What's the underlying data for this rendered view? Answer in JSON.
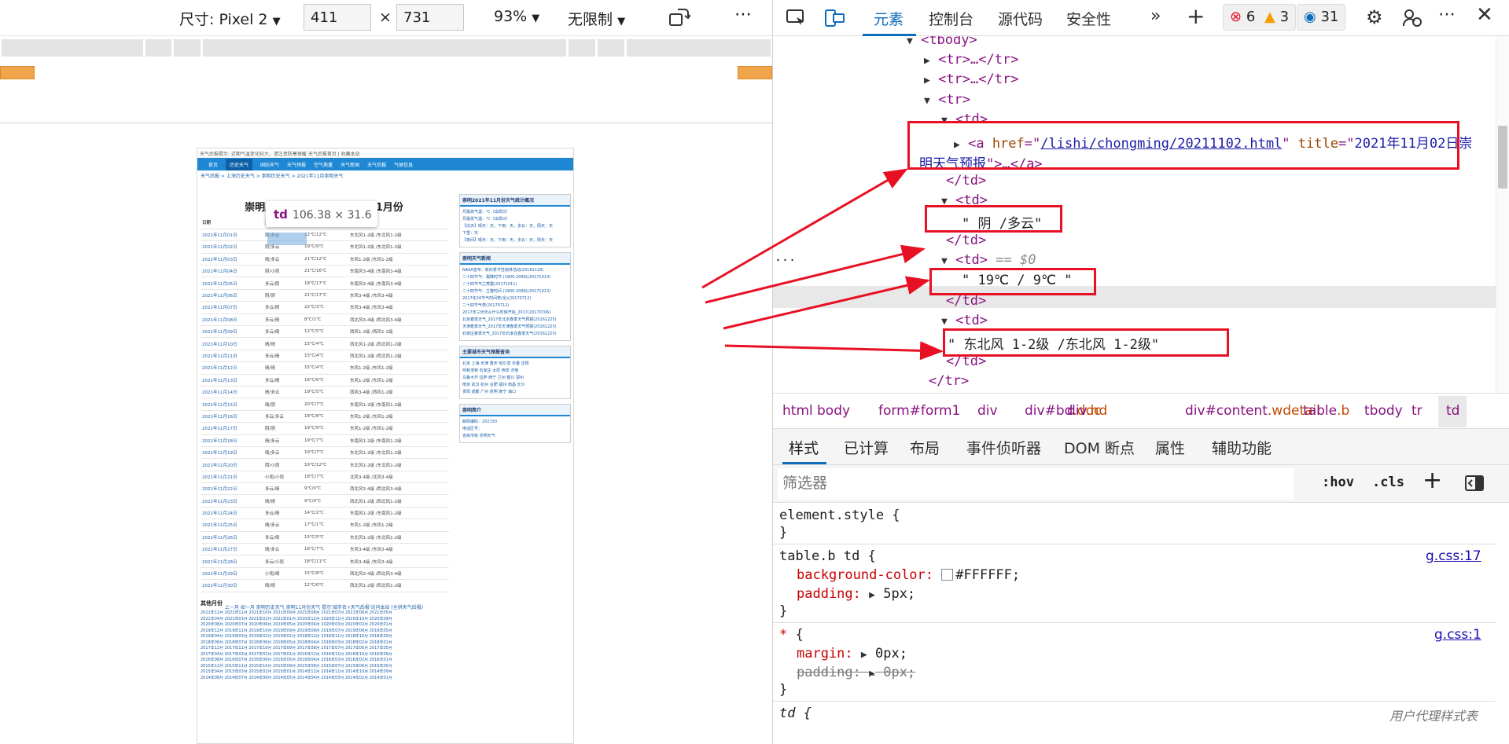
{
  "device_toolbar": {
    "size_label": "尺寸: Pixel 2",
    "width": "411",
    "x_sep": "×",
    "height": "731",
    "zoom": "93%",
    "throttle": "无限制"
  },
  "viewport_page": {
    "top_text": "天气后报提示: 近期气温变化较大，请注意防寒保暖   天气后报首页 | 收藏本站",
    "nav": [
      "首页",
      "历史天气",
      "国际天气",
      "天气预报",
      "空气质量",
      "天气新闻",
      "天气后报",
      "气候信息"
    ],
    "crumb": "天气后报 > 上海历史天气 > 崇明历史天气 > 2021年11月崇明天气",
    "title": "崇明历史天气预报 2021年11月份",
    "table_header": [
      "日期",
      "天气状况",
      "气温",
      "风力风向"
    ],
    "rows": [
      [
        "2021年11月01日",
        "阴/多云",
        "22℃/12℃",
        "东北风1-2级 /东北风1-2级"
      ],
      [
        "2021年11月02日",
        "阴/多云",
        "19℃/9℃",
        "东北风1-2级 /东北风1-2级"
      ],
      [
        "2021年11月03日",
        "晴/多云",
        "21℃/12℃",
        "东风1-2级 /东风1-2级"
      ],
      [
        "2021年11月04日",
        "阴/小雨",
        "21℃/16℃",
        "东南风3-4级 /东南风3-4级"
      ],
      [
        "2021年11月05日",
        "多云/阴",
        "18℃/17℃",
        "东南风3-4级 /东南风3-4级"
      ],
      [
        "2021年11月06日",
        "阴/阴",
        "21℃/17℃",
        "东风3-4级 /东风3-4级"
      ],
      [
        "2021年11月07日",
        "多云/阴",
        "22℃/3℃",
        "东风3-4级 /东风3-4级"
      ],
      [
        "2021年11月08日",
        "多云/晴",
        "8℃/1℃",
        "西北风3-4级 /西北风3-4级"
      ],
      [
        "2021年11月09日",
        "多云/晴",
        "12℃/5℃",
        "西风1-2级 /西风1-2级"
      ],
      [
        "2021年11月10日",
        "晴/晴",
        "15℃/4℃",
        "西北风1-2级 /西北风1-2级"
      ],
      [
        "2021年11月11日",
        "多云/晴",
        "15℃/4℃",
        "西北风1-2级 /西北风1-2级"
      ],
      [
        "2021年11月12日",
        "晴/晴",
        "15℃/4℃",
        "东风1-2级 /东风1-2级"
      ],
      [
        "2021年11月13日",
        "多云/晴",
        "16℃/6℃",
        "东风1-2级 /东风1-2级"
      ],
      [
        "2021年11月14日",
        "晴/多云",
        "19℃/5℃",
        "西风3-4级 /西风1-2级"
      ],
      [
        "2021年11月15日",
        "晴/阴",
        "20℃/7℃",
        "东南风1-2级 /东南风1-2级"
      ],
      [
        "2021年11月16日",
        "多云/多云",
        "18℃/8℃",
        "东风1-2级 /东风1-2级"
      ],
      [
        "2021年11月17日",
        "阴/阴",
        "19℃/9℃",
        "东风1-2级 /东风1-2级"
      ],
      [
        "2021年11月18日",
        "晴/多云",
        "19℃/7℃",
        "东南风1-2级 /东南风1-2级"
      ],
      [
        "2021年11月19日",
        "晴/多云",
        "19℃/7℃",
        "东北风1-2级 /东北风1-2级"
      ],
      [
        "2021年11月20日",
        "阴/小雨",
        "19℃/12℃",
        "东北风1-2级 /东北风1-2级"
      ],
      [
        "2021年11月21日",
        "小雨/小雨",
        "18℃/7℃",
        "北风3-4级 /北风3-4级"
      ],
      [
        "2021年11月22日",
        "多云/晴",
        "9℃/0℃",
        "西北风3-4级 /西北风3-4级"
      ],
      [
        "2021年11月23日",
        "晴/晴",
        "9℃/0℃",
        "西北风1-2级 /西北风1-2级"
      ],
      [
        "2021年11月24日",
        "多云/晴",
        "14℃/2℃",
        "东南风1-2级 /东南风1-2级"
      ],
      [
        "2021年11月25日",
        "晴/多云",
        "17℃/1℃",
        "东风1-2级 /东风1-2级"
      ],
      [
        "2021年11月26日",
        "多云/晴",
        "15℃/5℃",
        "东北风1-2级 /东北风1-2级"
      ],
      [
        "2021年11月27日",
        "晴/多云",
        "16℃/7℃",
        "东风3-4级 /东风3-4级"
      ],
      [
        "2021年11月28日",
        "多云/小雨",
        "18℃/11℃",
        "东风3-4级 /东风3-4级"
      ],
      [
        "2021年11月29日",
        "小雨/晴",
        "15℃/8℃",
        "西北风3-4级 /西北风3-4级"
      ],
      [
        "2021年11月30日",
        "晴/晴",
        "12℃/0℃",
        "西北风1-2级 /西北风1-2级"
      ]
    ],
    "below_table": "上一月 如一月 崇明历史天气 崇明11月份天气 提示'城市名+天气后报'访问本站 (全拼天气后报)",
    "side_boxes": [
      {
        "title": "崇明2021年11月份天气统计概况",
        "lines": [
          "月最高气温：℃（出现日）",
          "月最低气温：℃（出现日）",
          "【白天】晴天：天，下雨：天，多云：天，阴天：天",
          "下雪：天",
          "【夜间】晴天：天，下雨：天，多云：天，阴天：天"
        ]
      },
      {
        "title": "崇明天气新闻",
        "lines": [
          "NASA宣布：新的季节性雨林活动(20181118)",
          "二十四节气：霜降时节 (1900-2099)(20171014)",
          "二十四节气之寒露(20171011)",
          "二十四节气：立春时间 (1900-2099)(20171013)",
          "2017年24节气时间表(全)(20170712)",
          "二十四节气表(20170712)",
          "2017年三伏天从什么时候开始_2017(20170706)",
          "北京春季天气_2017年北京春季天气预报(20161225)",
          "天津春季天气_2017年天津春季天气预报(20161225)",
          "石家庄春季天气_2017年石家庄春季天气(20161225)"
        ]
      },
      {
        "title": "主要城市天气预报查询",
        "lines": [
          "北京 上海 天津 重庆 哈尔滨 长春 沈阳",
          "呼和浩特 石家庄 太原 西安 济南",
          "乌鲁木齐 拉萨 西宁 兰州 银川 郑州",
          "南京 武汉 杭州 合肥 福州 南昌 长沙",
          "贵阳 成都 广州 昆明 南宁 海口"
        ]
      },
      {
        "title": "崇明简介",
        "lines": [
          "邮政编码：202150",
          "电话区号：",
          "省级市级 崇明天气"
        ]
      }
    ],
    "other_months_title": "其他月份",
    "other_months_lines": [
      "2021年12月 2021年11月 2021年10月 2021年09月 2021年08月 2021年07月 2021年06月 2021年05月",
      "2021年04月 2021年03月 2021年02月 2021年01月 2020年12月 2020年11月 2020年10月 2020年09月",
      "2020年08月 2020年07月 2020年06月 2020年05月 2020年04月 2020年03月 2020年02月 2020年01月",
      "2019年12月 2019年11月 2019年10月 2019年09月 2019年08月 2019年07月 2019年06月 2019年05月",
      "2019年04月 2019年03月 2019年02月 2019年01月 2018年12月 2018年11月 2018年10月 2018年09月",
      "2018年08月 2018年07月 2018年06月 2018年05月 2018年04月 2018年03月 2018年02月 2018年01月",
      "2017年12月 2017年11月 2017年10月 2017年09月 2017年08月 2017年07月 2017年06月 2017年05月",
      "2017年04月 2017年03月 2017年02月 2017年01月 2016年12月 2016年11月 2016年10月 2016年09月",
      "2016年08月 2016年07月 2016年06月 2016年05月 2016年04月 2016年03月 2016年02月 2016年01月",
      "2015年12月 2015年11月 2015年10月 2015年09月 2015年08月 2015年07月 2015年06月 2015年05月",
      "2015年04月 2015年03月 2015年02月 2015年01月 2014年12月 2014年11月 2014年10月 2014年09月",
      "2014年08月 2014年07月 2014年06月 2014年05月 2014年04月 2014年03月 2014年02月 2014年01月"
    ],
    "tooltip": {
      "tag": "td",
      "dim": "106.38 × 31.6"
    }
  },
  "devtools": {
    "tabs": [
      "元素",
      "控制台",
      "源代码",
      "安全性"
    ],
    "errors": "6",
    "warnings": "3",
    "issues": "31",
    "dom": {
      "tbody": "<tbody>",
      "tr_collapsed_1": "<tr>…</tr>",
      "tr_collapsed_2": "<tr>…</tr>",
      "tr_open": "<tr>",
      "td_open": "<td>",
      "a_tag": "<a",
      "href_name": "href",
      "href_value": "/lishi/chongming/20211102.html",
      "title_name": "title",
      "title_value_1": "2021年11月02日崇",
      "title_value_2": "明天气预报",
      "a_close": ">…</a>",
      "td_close": "</td>",
      "text_weather": "\" 阴 /多云\"",
      "selected_marker": "== $0",
      "text_temp": "\" 19℃ / 9℃ \"",
      "text_wind": "\" 东北风 1-2级 /东北风 1-2级\"",
      "tr_close": "</tr>",
      "ellipsis": "..."
    },
    "breadcrumbs": [
      "html",
      "body",
      "form#form1",
      "div",
      "div#bd.doc",
      "div.hd",
      "div#content.wdetail",
      "table.b",
      "tbody",
      "tr",
      "td"
    ],
    "sub_tabs": [
      "样式",
      "已计算",
      "布局",
      "事件侦听器",
      "DOM 断点",
      "属性",
      "辅助功能"
    ],
    "filter_placeholder": "筛选器",
    "hov": ":hov",
    "cls": ".cls",
    "styles": {
      "element_style": "element.style {",
      "close": "}",
      "rule1_selector": "table.b td {",
      "rule1_src": "g.css:17",
      "bg_prop": "background-color:",
      "bg_val": "#FFFFFF;",
      "padding_prop": "padding:",
      "padding_val": "5px;",
      "rule2_selector": "* {",
      "rule2_src": "g.css:1",
      "margin_prop": "margin:",
      "margin_val": "0px;",
      "padding2_prop": "padding:",
      "padding2_val": "0px;",
      "rule3_selector": "td {",
      "rule3_src": "用户代理样式表"
    }
  },
  "colors": {
    "annotation": "#e81123",
    "accent": "#0f6cbd",
    "nav": "#1e88d4"
  }
}
